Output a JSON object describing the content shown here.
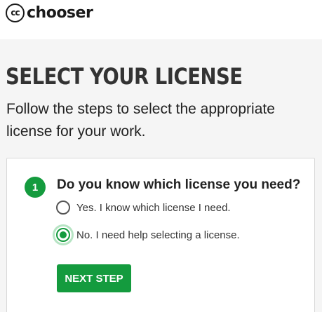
{
  "header": {
    "logo_mark": "cc",
    "logo_text": "chooser"
  },
  "page": {
    "title": "SELECT YOUR LICENSE",
    "subtitle": "Follow the steps to select the appropriate license for your work."
  },
  "step": {
    "number": "1",
    "question": "Do you know which license you need?",
    "options": [
      {
        "label": "Yes. I know which license I need.",
        "selected": false
      },
      {
        "label": "No. I need help selecting a license.",
        "selected": true
      }
    ],
    "next_label": "NEXT STEP"
  },
  "colors": {
    "accent": "#149b3e",
    "background": "#f5f5f5",
    "text": "#333333"
  }
}
